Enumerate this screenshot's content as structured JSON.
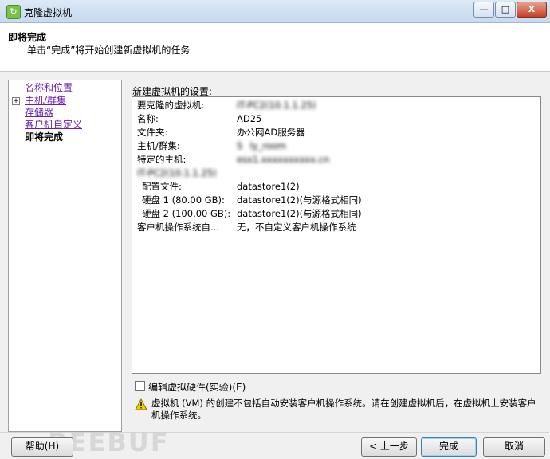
{
  "window": {
    "title": "克隆虚拟机",
    "minimize_glyph": "—",
    "maximize_glyph": "□",
    "close_glyph": "X"
  },
  "header": {
    "title": "即将完成",
    "subtitle": "单击“完成”将开始创建新虚拟机的任务"
  },
  "nav": {
    "items": [
      {
        "label": "名称和位置",
        "state": "link"
      },
      {
        "label": "主机/群集",
        "state": "link",
        "expandable": true
      },
      {
        "label": "存储器",
        "state": "link"
      },
      {
        "label": "客户机自定义",
        "state": "link"
      },
      {
        "label": "即将完成",
        "state": "current"
      }
    ],
    "expander_glyph": "+"
  },
  "settings": {
    "label": "新建虚拟机的设置:",
    "rows": [
      {
        "key": "要克隆的虚拟机:",
        "value": "IT-PC2(10.1.1.25)"
      },
      {
        "key": "名称:",
        "value": "AD25"
      },
      {
        "key": "文件夹:",
        "value": "办公网AD服务器"
      },
      {
        "key": "主机/群集:",
        "value": "S    ly_room"
      },
      {
        "key": "特定的主机:",
        "value": "esx1.xxxxxxxxxx.cn"
      },
      {
        "key": "IT-PC2(10.1.1.25)",
        "value": ""
      },
      {
        "key": "配置文件:",
        "value": "datastore1(2)"
      },
      {
        "key": "硬盘 1 (80.00 GB):",
        "value": "datastore1(2)(与源格式相同)"
      },
      {
        "key": "硬盘 2 (100.00 GB):",
        "value": "datastore1(2)(与源格式相同)"
      },
      {
        "key": "客户机操作系统自...",
        "value": "无，不自定义客户机操作系统"
      }
    ]
  },
  "edit_hardware": {
    "label": "编辑虚拟硬件(实验)(E)",
    "checked": false
  },
  "warning": {
    "text": "虚拟机 (VM) 的创建不包括自动安装客户机操作系统。请在创建虚拟机后，在虚拟机上安装客户机操作系统。"
  },
  "buttons": {
    "help": "帮助(H)",
    "back": "< 上一步",
    "finish": "完成",
    "cancel": "取消"
  },
  "watermark": "REEBUF",
  "colors": {
    "link": "#6a1fb0",
    "warning_fill": "#f5d000"
  }
}
